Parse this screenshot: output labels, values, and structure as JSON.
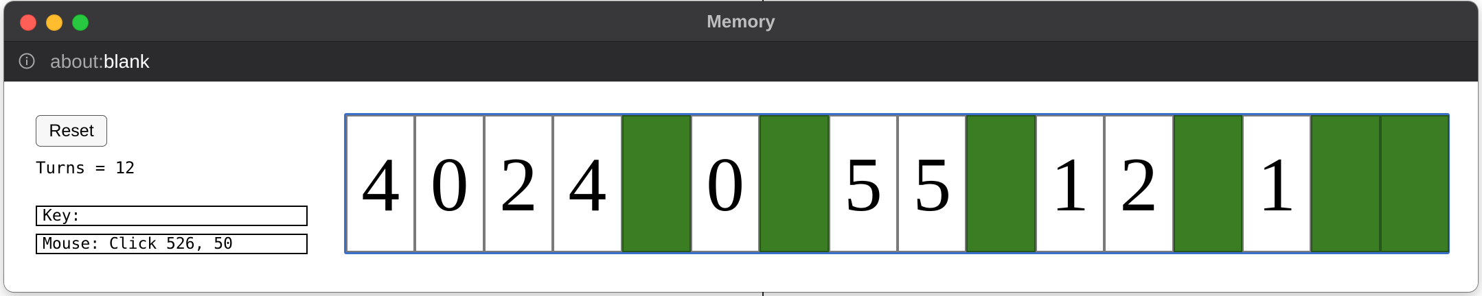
{
  "window": {
    "title": "Memory",
    "url_scheme": "about:",
    "url_rest": "blank"
  },
  "controls": {
    "reset_label": "Reset",
    "turns_text": "Turns = 12",
    "key_text": "Key:",
    "mouse_text": "Mouse: Click 526, 50"
  },
  "colors": {
    "hidden_card": "#3a7d22",
    "board_border": "#3a70c8"
  },
  "cards": [
    {
      "value": "4",
      "revealed": true
    },
    {
      "value": "0",
      "revealed": true
    },
    {
      "value": "2",
      "revealed": true
    },
    {
      "value": "4",
      "revealed": true
    },
    {
      "value": "",
      "revealed": false
    },
    {
      "value": "0",
      "revealed": true
    },
    {
      "value": "",
      "revealed": false
    },
    {
      "value": "5",
      "revealed": true
    },
    {
      "value": "5",
      "revealed": true
    },
    {
      "value": "",
      "revealed": false
    },
    {
      "value": "1",
      "revealed": true
    },
    {
      "value": "2",
      "revealed": true
    },
    {
      "value": "",
      "revealed": false
    },
    {
      "value": "1",
      "revealed": true
    },
    {
      "value": "",
      "revealed": false
    },
    {
      "value": "",
      "revealed": false
    }
  ],
  "icons": {
    "info": "info-icon"
  }
}
